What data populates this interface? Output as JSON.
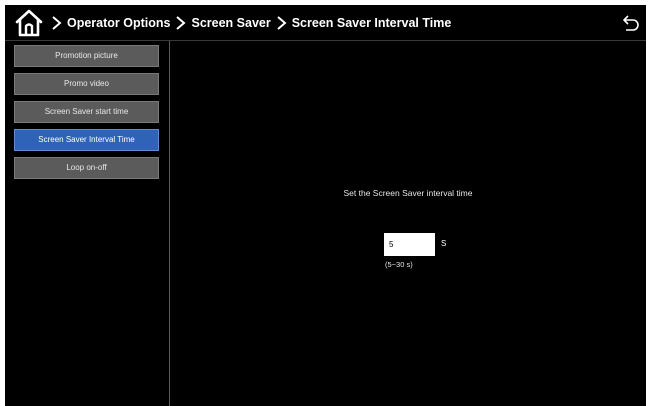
{
  "header": {
    "home_icon": "home-icon",
    "breadcrumb": [
      "Operator Options",
      "Screen Saver",
      "Screen Saver Interval Time"
    ],
    "separator_icon": "chevron-right-icon",
    "back_icon": "back-arrow-icon"
  },
  "sidebar": {
    "items": [
      {
        "label": "Promotion picture",
        "active": false
      },
      {
        "label": "Promo video",
        "active": false
      },
      {
        "label": "Screen Saver start time",
        "active": false
      },
      {
        "label": "Screen Saver Interval Time",
        "active": true
      },
      {
        "label": "Loop on-off",
        "active": false
      }
    ]
  },
  "main": {
    "prompt": "Set the Screen Saver interval time",
    "interval_value": "5",
    "unit": "S",
    "range_hint": "(5~30 s)"
  },
  "colors": {
    "background": "#000000",
    "button": "#5b5b5b",
    "active_button": "#2f63b8",
    "text": "#ffffff"
  }
}
